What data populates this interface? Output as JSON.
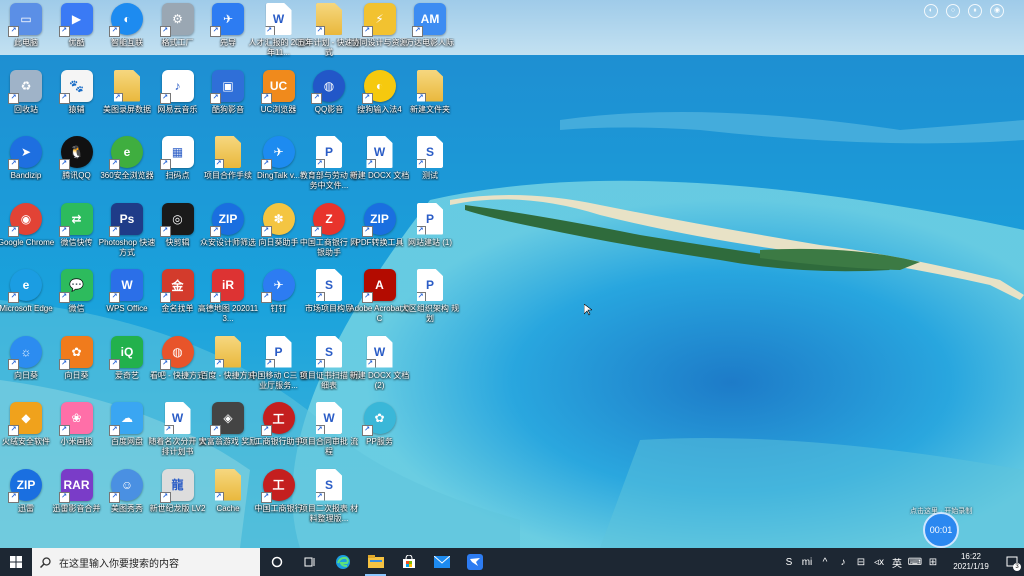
{
  "desktop": {
    "icons": [
      {
        "col": 0,
        "row": 0,
        "label": "此电脑",
        "color": "#5b8fe6",
        "glyph": "▭",
        "icon": "this-pc-icon"
      },
      {
        "col": 0,
        "row": 1,
        "label": "回收站",
        "color": "#9fb3c8",
        "glyph": "♻",
        "icon": "recycle-bin-icon"
      },
      {
        "col": 0,
        "row": 2,
        "label": "Bandizip",
        "color": "#1e6fe0",
        "glyph": "➤",
        "icon": "bandizip-icon",
        "round": true
      },
      {
        "col": 0,
        "row": 3,
        "label": "Google Chrome",
        "color": "#e24335",
        "glyph": "◉",
        "icon": "chrome-icon",
        "round": true
      },
      {
        "col": 0,
        "row": 4,
        "label": "Microsoft Edge",
        "color": "#1b9de2",
        "glyph": "e",
        "icon": "edge-icon",
        "round": true
      },
      {
        "col": 0,
        "row": 5,
        "label": "向日葵",
        "color": "#2c8cf0",
        "glyph": "☼",
        "icon": "sunflower-icon",
        "round": true
      },
      {
        "col": 0,
        "row": 6,
        "label": "火绒安全软件",
        "color": "#f0a21c",
        "glyph": "◆",
        "icon": "huorong-icon"
      },
      {
        "col": 0,
        "row": 7,
        "label": "迅雷",
        "color": "#1a6fe0",
        "glyph": "ZIP",
        "icon": "zip-icon",
        "round": true
      },
      {
        "col": 1,
        "row": 0,
        "label": "优酷",
        "color": "#3a7af5",
        "glyph": "▶",
        "icon": "youku-icon"
      },
      {
        "col": 1,
        "row": 1,
        "label": "猿辅",
        "color": "#f5f5f5",
        "glyph": "🐾",
        "icon": "mascot-icon"
      },
      {
        "col": 1,
        "row": 2,
        "label": "腾讯QQ",
        "color": "#111",
        "glyph": "🐧",
        "icon": "qq-icon",
        "round": true
      },
      {
        "col": 1,
        "row": 3,
        "label": "微信快传",
        "color": "#2dbb5d",
        "glyph": "⇄",
        "icon": "transfer-icon"
      },
      {
        "col": 1,
        "row": 4,
        "label": "微信",
        "color": "#2dbb5d",
        "glyph": "💬",
        "icon": "wechat-icon"
      },
      {
        "col": 1,
        "row": 5,
        "label": "向日葵",
        "color": "#f07b1c",
        "glyph": "✿",
        "icon": "sunlogin-icon"
      },
      {
        "col": 1,
        "row": 6,
        "label": "小米画报",
        "color": "#ff6fa8",
        "glyph": "❀",
        "icon": "mi-wallpaper-icon"
      },
      {
        "col": 1,
        "row": 7,
        "label": "迅雷影音合并",
        "color": "#7a3cc8",
        "glyph": "RAR",
        "icon": "rar-icon"
      },
      {
        "col": 2,
        "row": 0,
        "label": "智能互联",
        "color": "#1d8bf0",
        "glyph": "◐",
        "icon": "smart-connect-icon",
        "round": true
      },
      {
        "col": 2,
        "row": 1,
        "label": "美图录屏数据",
        "color": "#f2d27a",
        "glyph": "",
        "icon": "folder-icon",
        "doc": true
      },
      {
        "col": 2,
        "row": 2,
        "label": "360安全浏览器",
        "color": "#3fae3f",
        "glyph": "e",
        "icon": "360-browser-icon",
        "round": true
      },
      {
        "col": 2,
        "row": 3,
        "label": "Photoshop 快速方式",
        "color": "#1f3c88",
        "glyph": "Ps",
        "icon": "photoshop-icon"
      },
      {
        "col": 2,
        "row": 4,
        "label": "WPS Office",
        "color": "#2b6fe8",
        "glyph": "W",
        "icon": "wps-icon"
      },
      {
        "col": 2,
        "row": 5,
        "label": "爱奇艺",
        "color": "#22b14c",
        "glyph": "iQ",
        "icon": "iqiyi-icon"
      },
      {
        "col": 2,
        "row": 6,
        "label": "百度网盘",
        "color": "#3aa6f2",
        "glyph": "☁",
        "icon": "baidu-netdisk-icon"
      },
      {
        "col": 2,
        "row": 7,
        "label": "美图秀秀",
        "color": "#4a90e2",
        "glyph": "☺",
        "icon": "meitu-icon",
        "round": true
      },
      {
        "col": 3,
        "row": 0,
        "label": "格式工厂",
        "color": "#9aa7b3",
        "glyph": "⚙",
        "icon": "format-factory-icon"
      },
      {
        "col": 3,
        "row": 1,
        "label": "网易云音乐",
        "color": "#ffffff",
        "glyph": "♪",
        "icon": "music-icon",
        "dark": true
      },
      {
        "col": 3,
        "row": 2,
        "label": "扫码点",
        "color": "#ffffff",
        "glyph": "▦",
        "icon": "qrcode-icon",
        "dark": true
      },
      {
        "col": 3,
        "row": 3,
        "label": "快剪辑",
        "color": "#1a1a1a",
        "glyph": "◎",
        "icon": "video-editor-icon"
      },
      {
        "col": 3,
        "row": 4,
        "label": "金名找单",
        "color": "#d33b2c",
        "glyph": "金",
        "icon": "finder-icon"
      },
      {
        "col": 3,
        "row": 5,
        "label": "看吧 - 快捷方式",
        "color": "#e8542a",
        "glyph": "◍",
        "icon": "app-circle-icon",
        "round": true
      },
      {
        "col": 3,
        "row": 6,
        "label": "随着名次分开 安排计划书",
        "color": "#ffffff",
        "glyph": "W",
        "icon": "word-doc-icon",
        "doc": true,
        "dark": true
      },
      {
        "col": 3,
        "row": 7,
        "label": "新世纪龙版 LV2",
        "color": "#dddddd",
        "glyph": "龍",
        "icon": "dragon-icon",
        "dark": true
      },
      {
        "col": 4,
        "row": 0,
        "label": "先导",
        "color": "#2d7cf2",
        "glyph": "✈",
        "icon": "dingtalk-icon"
      },
      {
        "col": 4,
        "row": 1,
        "label": "酷狗影音",
        "color": "#2f6fd8",
        "glyph": "▣",
        "icon": "player-icon"
      },
      {
        "col": 4,
        "row": 2,
        "label": "项目合作手续",
        "color": "#f2d27a",
        "glyph": "",
        "icon": "folder-icon",
        "doc": true
      },
      {
        "col": 4,
        "row": 3,
        "label": "众安设计师筛选",
        "color": "#1a6fe0",
        "glyph": "ZIP",
        "icon": "zip-icon",
        "round": true
      },
      {
        "col": 4,
        "row": 4,
        "label": "高德地图 2020113...",
        "color": "#d33",
        "glyph": "iR",
        "icon": "ir-icon"
      },
      {
        "col": 4,
        "row": 5,
        "label": "百度 - 快捷方式",
        "color": "#f2d27a",
        "glyph": "",
        "icon": "folder-icon",
        "doc": true
      },
      {
        "col": 4,
        "row": 6,
        "label": "大富翁游戏 奖励",
        "color": "#444",
        "glyph": "◈",
        "icon": "game-icon"
      },
      {
        "col": 4,
        "row": 7,
        "label": "Cache",
        "color": "#f2d27a",
        "glyph": "",
        "icon": "folder-icon",
        "doc": true
      },
      {
        "col": 5,
        "row": 0,
        "label": "人才汇报的 2020年11...",
        "color": "#ffffff",
        "glyph": "W",
        "icon": "word-doc-icon",
        "doc": true,
        "dark": true
      },
      {
        "col": 5,
        "row": 1,
        "label": "UC浏览器",
        "color": "#f08a1c",
        "glyph": "UC",
        "icon": "uc-browser-icon"
      },
      {
        "col": 5,
        "row": 2,
        "label": "DingTalk v...",
        "color": "#1d8bf0",
        "glyph": "✈",
        "icon": "dingtalk-icon",
        "round": true
      },
      {
        "col": 5,
        "row": 3,
        "label": "向日葵助手",
        "color": "#f4c542",
        "glyph": "✽",
        "icon": "palette-icon",
        "round": true
      },
      {
        "col": 5,
        "row": 4,
        "label": "钉钉",
        "color": "#2d7cf2",
        "glyph": "✈",
        "icon": "dingding-icon",
        "round": true
      },
      {
        "col": 5,
        "row": 5,
        "label": "中国移动 C三 营业厅服务...",
        "color": "#ffffff",
        "glyph": "P",
        "icon": "pdf-icon",
        "doc": true,
        "dark": true
      },
      {
        "col": 5,
        "row": 6,
        "label": "工商银行助手",
        "color": "#c41f1f",
        "glyph": "工",
        "icon": "icbc-icon",
        "round": true
      },
      {
        "col": 5,
        "row": 7,
        "label": "中国工商银行",
        "color": "#c41f1f",
        "glyph": "工",
        "icon": "icbc-icon",
        "round": true
      },
      {
        "col": 6,
        "row": 0,
        "label": "五年计划 - 快速方式",
        "color": "#f2d27a",
        "glyph": "",
        "icon": "folder-icon",
        "doc": true
      },
      {
        "col": 6,
        "row": 1,
        "label": "QQ影音",
        "color": "#2257c8",
        "glyph": "◍",
        "icon": "qq-player-icon",
        "round": true
      },
      {
        "col": 6,
        "row": 2,
        "label": "教育部与劳动 考务中文件...",
        "color": "#ffffff",
        "glyph": "P",
        "icon": "pdf-icon",
        "doc": true,
        "dark": true
      },
      {
        "col": 6,
        "row": 3,
        "label": "中国工商银行 网银助手",
        "color": "#e8342c",
        "glyph": "Z",
        "icon": "bank-helper-icon",
        "round": true
      },
      {
        "col": 6,
        "row": 4,
        "label": "市场项目构思",
        "color": "#ffffff",
        "glyph": "S",
        "icon": "spreadsheet-icon",
        "doc": true,
        "dark": true
      },
      {
        "col": 6,
        "row": 5,
        "label": "项目证书扫描 明细表",
        "color": "#ffffff",
        "glyph": "S",
        "icon": "spreadsheet-icon",
        "doc": true,
        "dark": true
      },
      {
        "col": 6,
        "row": 6,
        "label": "项目合同审批 流程",
        "color": "#ffffff",
        "glyph": "W",
        "icon": "word-doc-icon",
        "doc": true,
        "dark": true
      },
      {
        "col": 6,
        "row": 7,
        "label": "项目二次报表 材料整理版...",
        "color": "#ffffff",
        "glyph": "S",
        "icon": "spreadsheet-icon",
        "doc": true,
        "dark": true
      },
      {
        "col": 7,
        "row": 0,
        "label": "协同设计与资源",
        "color": "#f2c230",
        "glyph": "⚡",
        "icon": "collab-icon"
      },
      {
        "col": 7,
        "row": 1,
        "label": "搜狗输入法4",
        "color": "#f6c90e",
        "glyph": "◐",
        "icon": "sogou-icon",
        "round": true
      },
      {
        "col": 7,
        "row": 2,
        "label": "新建 DOCX 文档",
        "color": "#ffffff",
        "glyph": "W",
        "icon": "word-doc-icon",
        "doc": true,
        "dark": true
      },
      {
        "col": 7,
        "row": 3,
        "label": "PDF转换工具",
        "color": "#1a6fe0",
        "glyph": "ZIP",
        "icon": "zip-icon",
        "round": true
      },
      {
        "col": 7,
        "row": 4,
        "label": "Adobe Acrobat DC",
        "color": "#b30b00",
        "glyph": "A",
        "icon": "acrobat-icon"
      },
      {
        "col": 7,
        "row": 5,
        "label": "新建 DOCX 文档 (2)",
        "color": "#ffffff",
        "glyph": "W",
        "icon": "word-doc-icon",
        "doc": true,
        "dark": true
      },
      {
        "col": 7,
        "row": 6,
        "label": "PP服务",
        "color": "#3ab7d8",
        "glyph": "✿",
        "icon": "pp-service-icon",
        "round": true
      },
      {
        "col": 8,
        "row": 0,
        "label": "万达电影人际",
        "color": "#3d8cf2",
        "glyph": "AM",
        "icon": "am-icon"
      },
      {
        "col": 8,
        "row": 1,
        "label": "新建文件夹",
        "color": "#f2d27a",
        "glyph": "",
        "icon": "folder-icon",
        "doc": true
      },
      {
        "col": 8,
        "row": 2,
        "label": "测试",
        "color": "#ffffff",
        "glyph": "S",
        "icon": "spreadsheet-icon",
        "doc": true,
        "dark": true
      },
      {
        "col": 8,
        "row": 3,
        "label": "网站建站 (1)",
        "color": "#ffffff",
        "glyph": "P",
        "icon": "ppt-icon",
        "doc": true,
        "dark": true
      },
      {
        "col": 8,
        "row": 4,
        "label": "大区组织架构 规划",
        "color": "#ffffff",
        "glyph": "P",
        "icon": "ppt-icon",
        "doc": true,
        "dark": true
      }
    ]
  },
  "top_icons": [
    "◐",
    "○",
    "⏸",
    "◉"
  ],
  "recording": {
    "time": "00:01",
    "hint": "点击这里 · 开始录制"
  },
  "taskbar": {
    "search_placeholder": "在这里输入你要搜索的内容",
    "tray": [
      "S",
      "mi",
      "^",
      "♪",
      "⊟",
      "◃x",
      "英",
      "⌨",
      "⊞"
    ],
    "time": "16:22",
    "date": "2021/1/19",
    "notifications": "3"
  },
  "colors": {
    "taskbar_bg": "#1d2733",
    "accent": "#2b88f0"
  }
}
